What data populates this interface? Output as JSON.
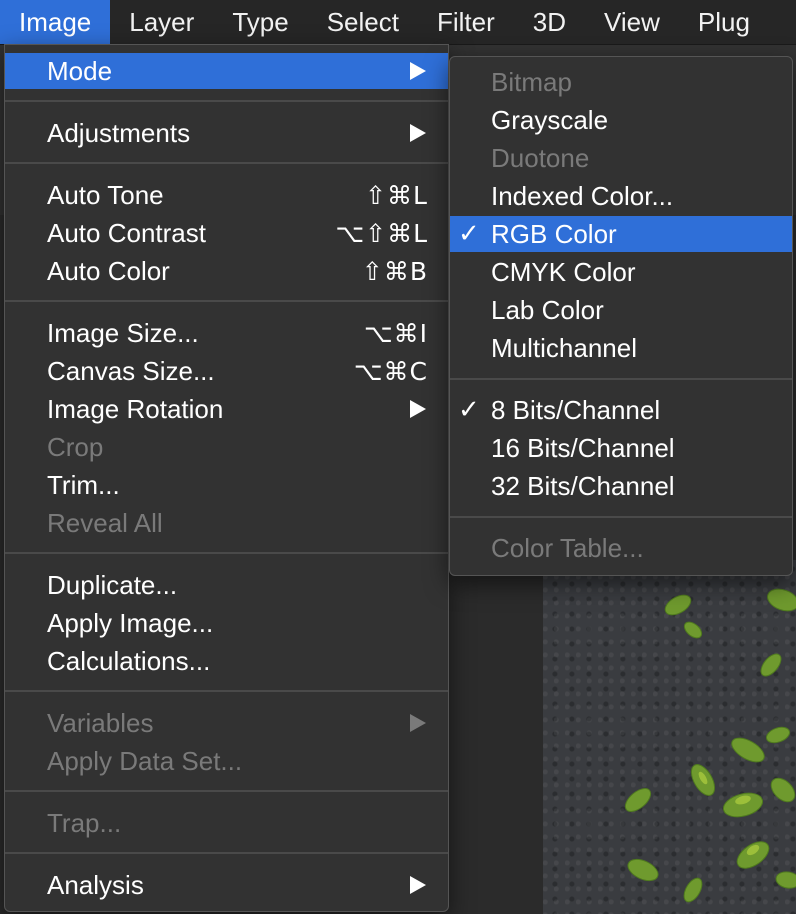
{
  "menubar": {
    "items": [
      {
        "label": "Image"
      },
      {
        "label": "Layer"
      },
      {
        "label": "Type"
      },
      {
        "label": "Select"
      },
      {
        "label": "Filter"
      },
      {
        "label": "3D"
      },
      {
        "label": "View"
      },
      {
        "label": "Plug"
      }
    ],
    "active_index": 0
  },
  "image_menu": {
    "mode": {
      "label": "Mode"
    },
    "adjustments": {
      "label": "Adjustments"
    },
    "auto_tone": {
      "label": "Auto Tone",
      "shortcut": "⇧⌘L"
    },
    "auto_contrast": {
      "label": "Auto Contrast",
      "shortcut": "⌥⇧⌘L"
    },
    "auto_color": {
      "label": "Auto Color",
      "shortcut": "⇧⌘B"
    },
    "image_size": {
      "label": "Image Size...",
      "shortcut": "⌥⌘I"
    },
    "canvas_size": {
      "label": "Canvas Size...",
      "shortcut": "⌥⌘C"
    },
    "image_rotation": {
      "label": "Image Rotation"
    },
    "crop": {
      "label": "Crop",
      "disabled": true
    },
    "trim": {
      "label": "Trim..."
    },
    "reveal_all": {
      "label": "Reveal All",
      "disabled": true
    },
    "duplicate": {
      "label": "Duplicate..."
    },
    "apply_image": {
      "label": "Apply Image..."
    },
    "calculations": {
      "label": "Calculations..."
    },
    "variables": {
      "label": "Variables",
      "disabled": true
    },
    "apply_data_set": {
      "label": "Apply Data Set...",
      "disabled": true
    },
    "trap": {
      "label": "Trap...",
      "disabled": true
    },
    "analysis": {
      "label": "Analysis"
    }
  },
  "mode_submenu": {
    "bitmap": {
      "label": "Bitmap",
      "disabled": true
    },
    "grayscale": {
      "label": "Grayscale"
    },
    "duotone": {
      "label": "Duotone",
      "disabled": true
    },
    "indexed_color": {
      "label": "Indexed Color..."
    },
    "rgb_color": {
      "label": "RGB Color",
      "checked": true
    },
    "cmyk_color": {
      "label": "CMYK Color"
    },
    "lab_color": {
      "label": "Lab Color"
    },
    "multichannel": {
      "label": "Multichannel"
    },
    "bits_8": {
      "label": "8 Bits/Channel",
      "checked": true
    },
    "bits_16": {
      "label": "16 Bits/Channel"
    },
    "bits_32": {
      "label": "32 Bits/Channel"
    },
    "color_table": {
      "label": "Color Table...",
      "disabled": true
    },
    "check_glyph": "✓"
  },
  "colors": {
    "highlight": "#2f6fd8",
    "menu_bg": "#323232",
    "disabled_text": "#7a7a7a"
  }
}
